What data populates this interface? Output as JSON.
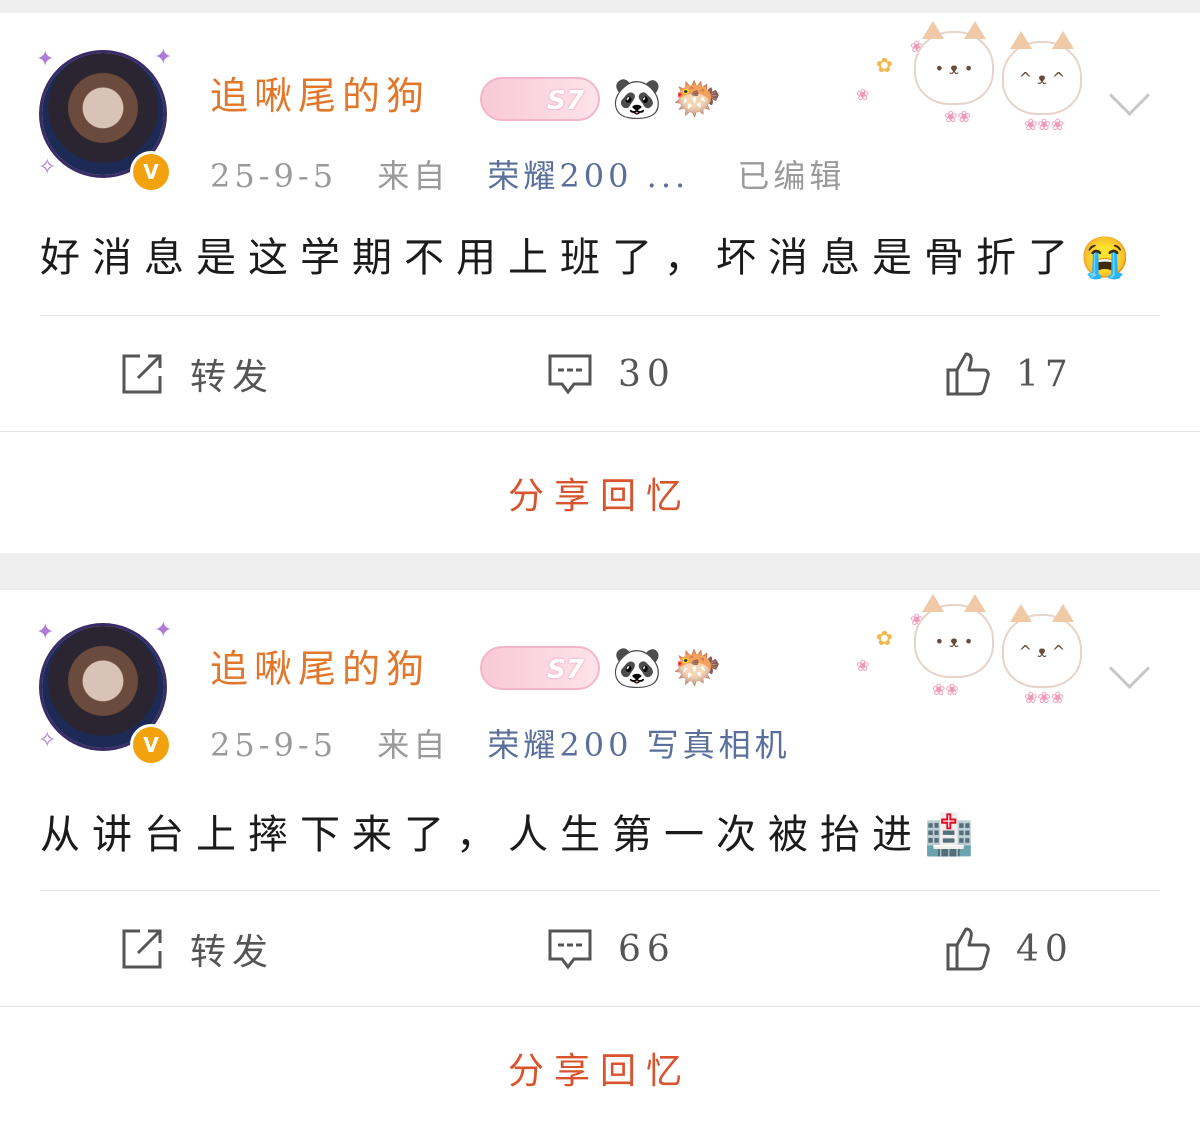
{
  "colors": {
    "name": "#e2762a",
    "device": "#5a6f9c",
    "share": "#d9532e",
    "vbadge": "#f2a10f"
  },
  "posts": [
    {
      "author": "追啾尾的狗",
      "level_badge": "S7",
      "date": "25-9-5",
      "from_label": "来自",
      "device": "荣耀200 ...",
      "edited": "已编辑",
      "text": "好消息是这学期不用上班了，坏消息是骨折了",
      "emoji": "😭",
      "repost_label": "转发",
      "comments": "30",
      "likes": "17",
      "share_label": "分享回忆"
    },
    {
      "author": "追啾尾的狗",
      "level_badge": "S7",
      "date": "25-9-5",
      "from_label": "来自",
      "device": "荣耀200 写真相机",
      "edited": "",
      "text": "从讲台上摔下来了，人生第一次被抬进",
      "emoji": "🏥",
      "repost_label": "转发",
      "comments": "66",
      "likes": "40",
      "share_label": "分享回忆"
    }
  ],
  "icons": {
    "verified": "v-badge-icon",
    "panda": "🐼",
    "fish": "🐡",
    "repost": "repost-icon",
    "comment": "comment-icon",
    "like": "thumbs-up-icon",
    "more": "chevron-down-icon"
  }
}
